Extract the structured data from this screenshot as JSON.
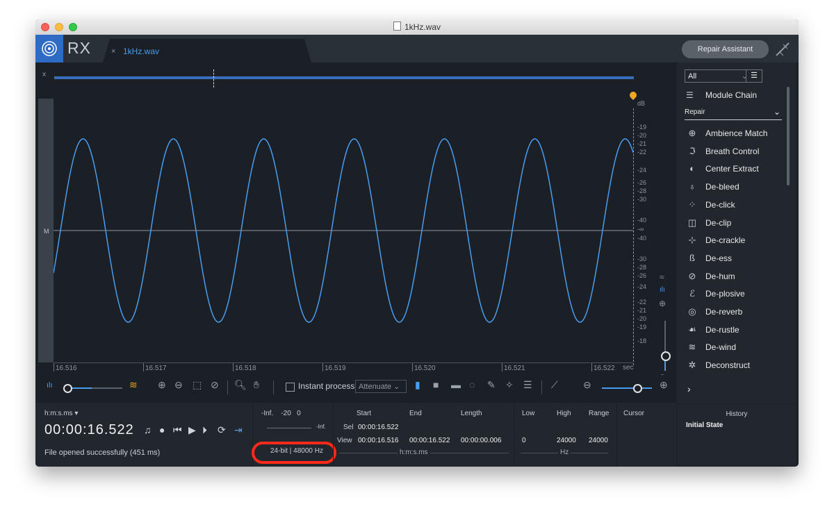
{
  "window": {
    "title": "1kHz.wav"
  },
  "app": {
    "logo_text": "RX",
    "tab_label": "1kHz.wav",
    "tab_close": "×",
    "repair_button": "Repair Assistant"
  },
  "waveform": {
    "channel_label": "M",
    "color": "#4a9cf0",
    "db_unit": "dB",
    "db_labels": [
      "-19",
      "-20",
      "-21",
      "-22",
      "-24",
      "-26",
      "-28",
      "-30",
      "-40",
      "-∞",
      "-40",
      "-30",
      "-28",
      "-26",
      "-24",
      "-22",
      "-21",
      "-20",
      "-19",
      "-18"
    ],
    "time_ticks": [
      "16.516",
      "16.517",
      "16.518",
      "16.519",
      "16.520",
      "16.521",
      "16.522"
    ],
    "time_unit": "sec"
  },
  "toolbar": {
    "instant_process_label": "Instant process",
    "attenuate_value": "Attenuate"
  },
  "bottom": {
    "time_format": "h:m:s.ms ▾",
    "current_time": "00:00:16.522",
    "status": "File opened successfully (451 ms)",
    "meter_labels": "-Inf.    -20   0",
    "meter_inf": "-Inf.",
    "bit_info": "24-bit | 48000 Hz",
    "sel_label": "Sel",
    "view_label": "View",
    "headers": {
      "start": "Start",
      "end": "End",
      "length": "Length",
      "low": "Low",
      "high": "High",
      "range": "Range",
      "cursor": "Cursor"
    },
    "sel": {
      "start": "00:00:16.522"
    },
    "view": {
      "start": "00:00:16.516",
      "end": "00:00:16.522",
      "length": "00:00:00.006",
      "low": "0",
      "high": "24000",
      "range": "24000"
    },
    "time_unit": "h:m:s.ms",
    "freq_unit": "Hz"
  },
  "modules": {
    "filter_value": "All",
    "module_chain": "Module Chain",
    "category": "Repair",
    "items": [
      {
        "label": "Ambience Match",
        "icon": "ambience-match-icon"
      },
      {
        "label": "Breath Control",
        "icon": "breath-control-icon"
      },
      {
        "label": "Center Extract",
        "icon": "center-extract-icon"
      },
      {
        "label": "De-bleed",
        "icon": "de-bleed-icon"
      },
      {
        "label": "De-click",
        "icon": "de-click-icon"
      },
      {
        "label": "De-clip",
        "icon": "de-clip-icon"
      },
      {
        "label": "De-crackle",
        "icon": "de-crackle-icon"
      },
      {
        "label": "De-ess",
        "icon": "de-ess-icon"
      },
      {
        "label": "De-hum",
        "icon": "de-hum-icon"
      },
      {
        "label": "De-plosive",
        "icon": "de-plosive-icon"
      },
      {
        "label": "De-reverb",
        "icon": "de-reverb-icon"
      },
      {
        "label": "De-rustle",
        "icon": "de-rustle-icon"
      },
      {
        "label": "De-wind",
        "icon": "de-wind-icon"
      },
      {
        "label": "Deconstruct",
        "icon": "deconstruct-icon"
      }
    ]
  },
  "history": {
    "title": "History",
    "state": "Initial State"
  }
}
